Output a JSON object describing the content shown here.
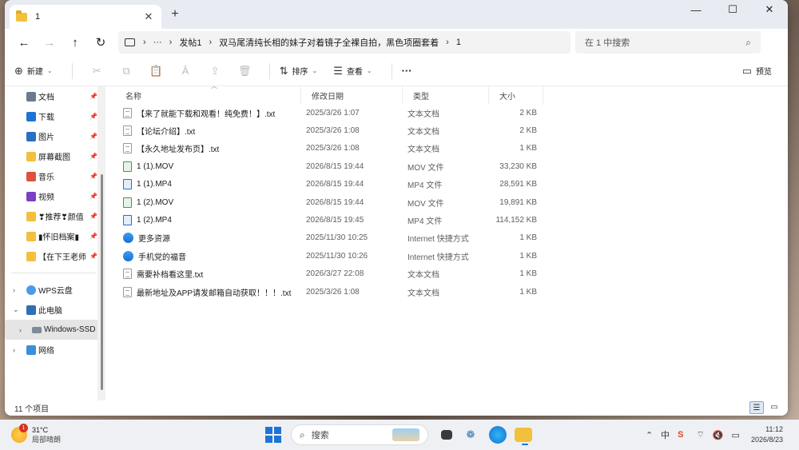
{
  "window": {
    "tab_title": "1",
    "minimize": "—",
    "maximize": "☐",
    "close": "✕"
  },
  "nav": {
    "path": [
      "发帖1",
      "双马尾清纯长相的妹子对着镜子全裸自拍，黑色项圈套着",
      "1"
    ],
    "search_placeholder": "在 1 中搜索"
  },
  "toolbar": {
    "new_label": "新建",
    "sort_label": "排序",
    "view_label": "查看",
    "more_label": "···",
    "preview_label": "预览"
  },
  "sidebar": {
    "quick_access": [
      {
        "label": "文档",
        "icon": "document-icon",
        "color": "#6b7a8f"
      },
      {
        "label": "下载",
        "icon": "download-icon",
        "color": "#1e74d6"
      },
      {
        "label": "图片",
        "icon": "picture-icon",
        "color": "#2a6fc4"
      },
      {
        "label": "屏幕截图",
        "icon": "folder-icon",
        "color": "#f2c03c"
      },
      {
        "label": "音乐",
        "icon": "music-icon",
        "color": "#e0513b"
      },
      {
        "label": "视频",
        "icon": "video-icon",
        "color": "#7b3fc4"
      },
      {
        "label": "❣推荐❣颜值",
        "icon": "folder-icon",
        "color": "#f2c03c"
      },
      {
        "label": "▮怀旧档案▮",
        "icon": "folder-icon",
        "color": "#f2c03c"
      },
      {
        "label": "【在下王老师",
        "icon": "folder-icon",
        "color": "#f2c03c"
      }
    ],
    "wps_cloud": "WPS云盘",
    "this_pc": "此电脑",
    "drive": "Windows-SSD",
    "network": "网络"
  },
  "columns": {
    "name": "名称",
    "date": "修改日期",
    "type": "类型",
    "size": "大小"
  },
  "files": [
    {
      "name": "【来了就能下载和观看！纯免费！】.txt",
      "date": "2025/3/26 1:07",
      "type": "文本文档",
      "size": "2 KB",
      "icon": "txt"
    },
    {
      "name": "【论坛介绍】.txt",
      "date": "2025/3/26 1:08",
      "type": "文本文档",
      "size": "2 KB",
      "icon": "txt"
    },
    {
      "name": "【永久地址发布页】.txt",
      "date": "2025/3/26 1:08",
      "type": "文本文档",
      "size": "1 KB",
      "icon": "txt"
    },
    {
      "name": "1 (1).MOV",
      "date": "2026/8/15 19:44",
      "type": "MOV 文件",
      "size": "33,230 KB",
      "icon": "mov"
    },
    {
      "name": "1 (1).MP4",
      "date": "2026/8/15 19:44",
      "type": "MP4 文件",
      "size": "28,591 KB",
      "icon": "mp4"
    },
    {
      "name": "1 (2).MOV",
      "date": "2026/8/15 19:44",
      "type": "MOV 文件",
      "size": "19,891 KB",
      "icon": "mov"
    },
    {
      "name": "1 (2).MP4",
      "date": "2026/8/15 19:45",
      "type": "MP4 文件",
      "size": "114,152 KB",
      "icon": "mp4"
    },
    {
      "name": "更多资源",
      "date": "2025/11/30 10:25",
      "type": "Internet 快捷方式",
      "size": "1 KB",
      "icon": "url"
    },
    {
      "name": "手机党的福音",
      "date": "2025/11/30 10:26",
      "type": "Internet 快捷方式",
      "size": "1 KB",
      "icon": "url"
    },
    {
      "name": "需要补档看这里.txt",
      "date": "2026/3/27 22:08",
      "type": "文本文档",
      "size": "1 KB",
      "icon": "txt"
    },
    {
      "name": "最新地址及APP请发邮箱自动获取！！！.txt",
      "date": "2025/3/26 1:08",
      "type": "文本文档",
      "size": "1 KB",
      "icon": "txt"
    }
  ],
  "status": {
    "item_count": "11 个项目"
  },
  "taskbar": {
    "weather_badge": "1",
    "temperature": "31°C",
    "condition": "局部晴朗",
    "search_label": "搜索",
    "ime_label": "中",
    "time": "11:12",
    "date": "2026/8/23"
  }
}
